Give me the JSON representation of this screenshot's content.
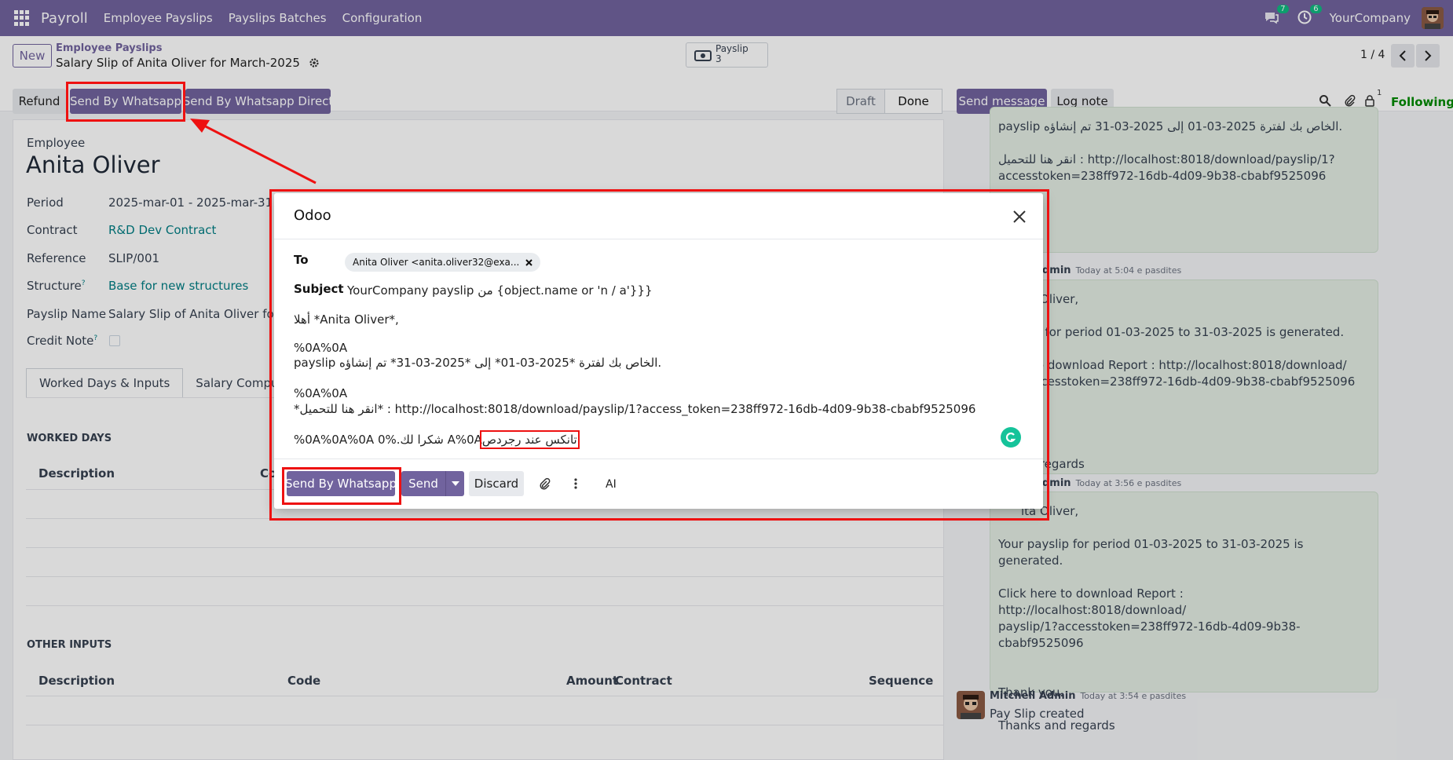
{
  "navbar": {
    "app": "Payroll",
    "menu": [
      "Employee Payslips",
      "Payslips Batches",
      "Configuration"
    ],
    "messages_count": "7",
    "activities_count": "6",
    "company": "YourCompany"
  },
  "control": {
    "new_label": "New",
    "breadcrumb_parent": "Employee Payslips",
    "breadcrumb_current": "Salary Slip of Anita Oliver for March-2025",
    "stat_label": "Payslip",
    "stat_count": "3",
    "pager": "1 / 4"
  },
  "actions": {
    "refund": "Refund",
    "send_whatsapp": "Send By Whatsapp",
    "send_whatsapp_direct": "Send By Whatsapp Direct",
    "status_draft": "Draft",
    "status_done": "Done"
  },
  "form": {
    "employee_label": "Employee",
    "employee_name": "Anita Oliver",
    "fields": [
      {
        "label": "Period",
        "value": "2025-mar-01 - 2025-mar-31",
        "link": false
      },
      {
        "label": "Contract",
        "value": "R&D Dev Contract",
        "link": true
      },
      {
        "label": "Reference",
        "value": "SLIP/001",
        "link": false
      },
      {
        "label": "Structure",
        "value": "Base for new structures",
        "link": true
      },
      {
        "label": "Payslip Name",
        "value": "Salary Slip of Anita Oliver for Ma",
        "link": false
      },
      {
        "label": "Credit Note",
        "value": "",
        "link": false
      }
    ],
    "help_mark": "?",
    "tabs": [
      "Worked Days & Inputs",
      "Salary Computation"
    ],
    "worked_days_title": "WORKED DAYS",
    "worked_days_headers": [
      "Description",
      "Co"
    ],
    "other_inputs_title": "OTHER INPUTS",
    "other_inputs_headers": [
      "Description",
      "Code",
      "Amount",
      "Contract",
      "Sequence"
    ]
  },
  "chatter": {
    "send_message": "Send message",
    "log_note": "Log note",
    "followers_count": "1",
    "following": "Following",
    "msg1": [
      "payslip الخاص بك لفترة 2025-03-01 إلى 2025-03-31 تم إنشاؤه.",
      "انقر هنا للتحميل : http://localhost:8018/download/payslip/1?",
      "accesstoken=238ff972-16db-4d09-9b38-cbabf9525096"
    ],
    "msg2_author": "dmin",
    "msg2_time": "Today at 5:04 e pasdites",
    "msg2": [
      "ita Oliver,",
      "slip for period 01-03-2025 to 31-03-2025 is generated.",
      "e to download Report : http://localhost:8018/download/",
      "?accesstoken=238ff972-16db-4d09-9b38-cbabf9525096",
      "u.",
      "nd regards"
    ],
    "msg3_author": "dmin",
    "msg3_time": "Today at 3:56 e pasdites",
    "msg3": [
      "ita Oliver,",
      "Your payslip for period 01-03-2025 to 31-03-2025 is generated.",
      "Click here to download Report : http://localhost:8018/download/",
      "payslip/1?accesstoken=238ff972-16db-4d09-9b38-cbabf9525096",
      "Thank you.",
      "Thanks and regards"
    ],
    "msg4_author": "Mitchell Admin",
    "msg4_time": "Today at 3:54 e pasdites",
    "msg4": "Pay Slip created"
  },
  "modal": {
    "title": "Odoo",
    "to_label": "To",
    "to_value": "Anita Oliver <anita.oliver32@exa...",
    "subject_label": "Subject",
    "subject_value": "YourCompany payslip من {object.name or 'n / a'}}}",
    "body": [
      "أهلا *Anita Oliver*,",
      "%0A%0A",
      "payslip الخاص بك لفترة *2025-03-01* إلى *2025-03-31* تم إنشاؤه.",
      "%0A%0A",
      "*انقر هنا للتحميل* : http://localhost:8018/download/payslip/1?access_token=238ff972-16db-4d09-9b38-cbabf9525096",
      "%0A%0A%0A 0%.شكرا لك A%0A"
    ],
    "body_highlight": "تانكس عند رجردص",
    "send_whatsapp": "Send By Whatsapp",
    "send": "Send",
    "discard": "Discard",
    "ai": "AI"
  },
  "colors": {
    "brand": "#71639e",
    "annotation": "#e11111",
    "chatter_bubble": "#e3ede3",
    "link": "#017e84"
  }
}
